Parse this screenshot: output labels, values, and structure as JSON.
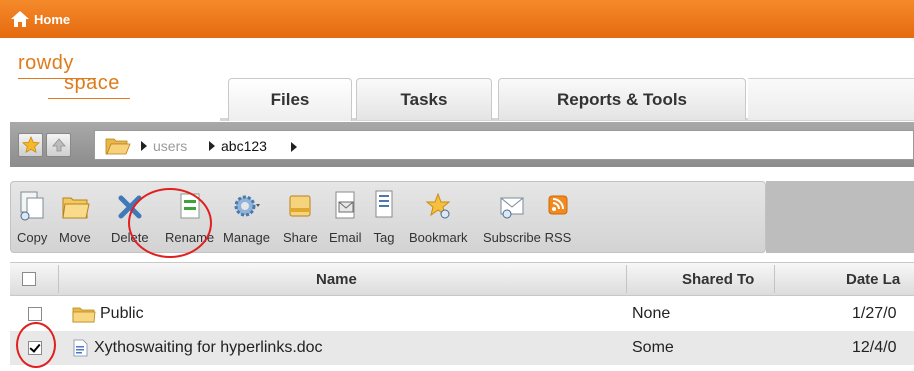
{
  "header": {
    "home_label": "Home"
  },
  "logo": {
    "line1": "rowdy",
    "line2": "space"
  },
  "tabs": [
    {
      "label": "Files",
      "active": true
    },
    {
      "label": "Tasks",
      "active": false
    },
    {
      "label": "Reports & Tools",
      "active": false
    }
  ],
  "breadcrumb": {
    "items": [
      "users",
      "abc123"
    ]
  },
  "toolbar": {
    "buttons": [
      {
        "label": "Copy",
        "icon": "copy-icon"
      },
      {
        "label": "Move",
        "icon": "move-icon"
      },
      {
        "label": "Delete",
        "icon": "delete-icon"
      },
      {
        "label": "Rename",
        "icon": "rename-icon"
      },
      {
        "label": "Manage",
        "icon": "gear-icon"
      },
      {
        "label": "Share",
        "icon": "share-icon"
      },
      {
        "label": "Email",
        "icon": "email-icon"
      },
      {
        "label": "Tag",
        "icon": "tag-icon"
      },
      {
        "label": "Bookmark",
        "icon": "star-icon"
      },
      {
        "label": "Subscribe",
        "icon": "subscribe-icon"
      },
      {
        "label": "RSS",
        "icon": "rss-icon"
      }
    ]
  },
  "grid": {
    "columns": {
      "name": "Name",
      "shared_to": "Shared To",
      "date": "Date La"
    },
    "rows": [
      {
        "name": "Public",
        "shared_to": "None",
        "date": "1/27/0",
        "checked": false,
        "type": "folder"
      },
      {
        "name": "Xythoswaiting for hyperlinks.doc",
        "shared_to": "Some",
        "date": "12/4/0",
        "checked": true,
        "type": "document"
      }
    ]
  },
  "colors": {
    "accent": "#f0801f",
    "logo": "#e07b1a",
    "highlight": "#e01f1f"
  }
}
